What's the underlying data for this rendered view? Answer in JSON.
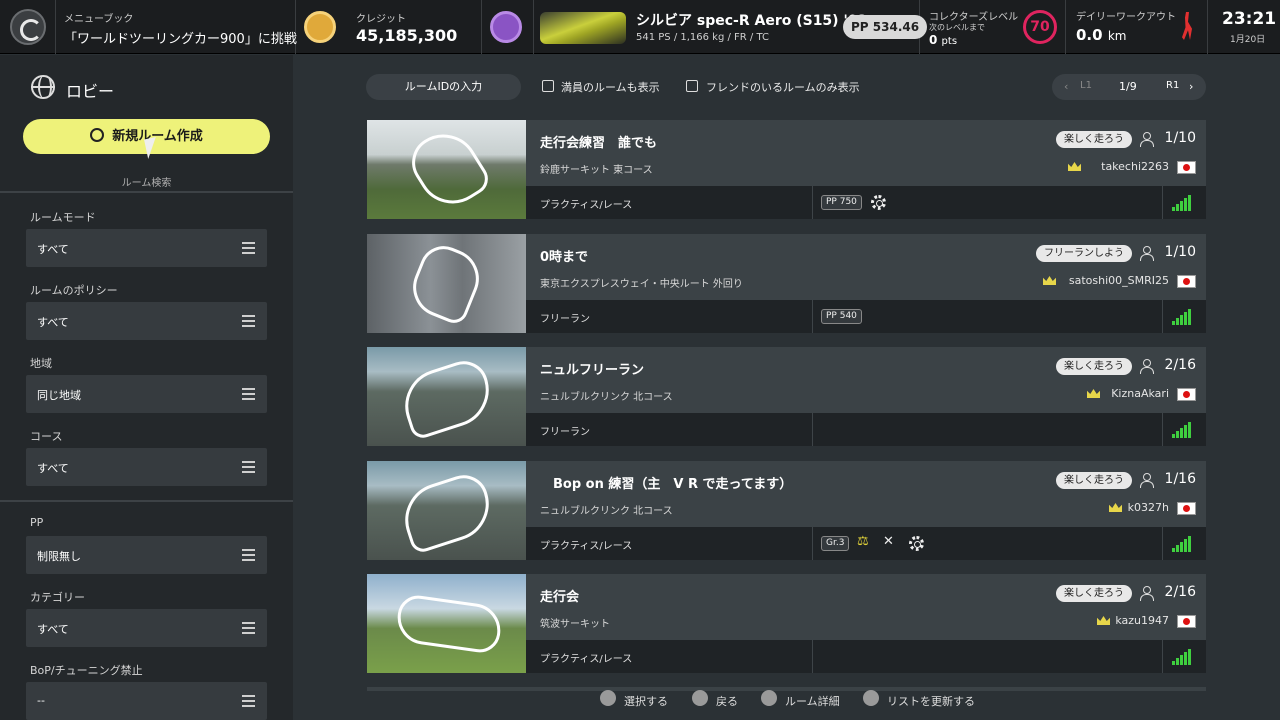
{
  "header": {
    "menubook_label": "メニューブック",
    "menubook_value": "「ワールドツーリングカー900」に挑戦",
    "credit_label": "クレジット",
    "credit_value": "45,185,300",
    "car_name": "シルビア spec-R Aero (S15) '02",
    "car_specs": "541 PS / 1,166 kg / FR / TC",
    "pp_value": "PP 534.46",
    "collector_label": "コレクターズレベル",
    "collector_next": "次のレベルまで",
    "collector_pts": "0",
    "collector_pts_unit": "pts",
    "collector_level": "70",
    "workout_label": "デイリーワークアウト",
    "workout_value": "0.0",
    "workout_unit": "km",
    "time": "23:21",
    "date": "1月20日"
  },
  "sidebar": {
    "title": "ロビー",
    "new_room_label": "新規ルーム作成",
    "room_search_label": "ルーム検索",
    "filters": [
      {
        "label": "ルームモード",
        "value": "すべて"
      },
      {
        "label": "ルームのポリシー",
        "value": "すべて"
      },
      {
        "label": "地域",
        "value": "同じ地域"
      },
      {
        "label": "コース",
        "value": "すべて"
      },
      {
        "label": "PP",
        "value": "制限無し"
      },
      {
        "label": "カテゴリー",
        "value": "すべて"
      },
      {
        "label": "BoP/チューニング禁止",
        "value": "--"
      }
    ]
  },
  "toolbar": {
    "room_id_button": "ルームIDの入力",
    "show_full_rooms": "満員のルームも表示",
    "friends_only": "フレンドのいるルームのみ表示",
    "pager_l1": "L1",
    "pager_page": "1/9",
    "pager_r1": "R1"
  },
  "rooms": [
    {
      "name": "走行会練習　誰でも",
      "course": "鈴鹿サーキット 東コース",
      "policy": "楽しく走ろう",
      "count": "1/10",
      "host": "takechi2263",
      "mode": "プラクティス/レース",
      "pp_tag": "PP 750"
    },
    {
      "name": "0時まで",
      "course": "東京エクスプレスウェイ・中央ルート 外回り",
      "policy": "フリーランしよう",
      "count": "1/10",
      "host": "satoshi00_SMRI25",
      "mode": "フリーラン",
      "pp_tag": "PP 540"
    },
    {
      "name": "ニュルフリーラン",
      "course": "ニュルブルクリンク 北コース",
      "policy": "楽しく走ろう",
      "count": "2/16",
      "host": "KiznaAkari",
      "mode": "フリーラン"
    },
    {
      "name": "　Bop on 練習（主　V R で走ってます）",
      "course": "ニュルブルクリンク 北コース",
      "policy": "楽しく走ろう",
      "count": "1/16",
      "host": "k0327h",
      "mode": "プラクティス/レース",
      "category_tag": "Gr.3"
    },
    {
      "name": "走行会",
      "course": "筑波サーキット",
      "policy": "楽しく走ろう",
      "count": "2/16",
      "host": "kazu1947",
      "mode": "プラクティス/レース"
    }
  ],
  "hints": {
    "select": "選択する",
    "back": "戻る",
    "room_detail": "ルーム詳細",
    "refresh": "リストを更新する"
  },
  "colors": {
    "accent_yellow": "#eef27a",
    "level_pink": "#e0245f",
    "signal_green": "#3fcf3f"
  }
}
